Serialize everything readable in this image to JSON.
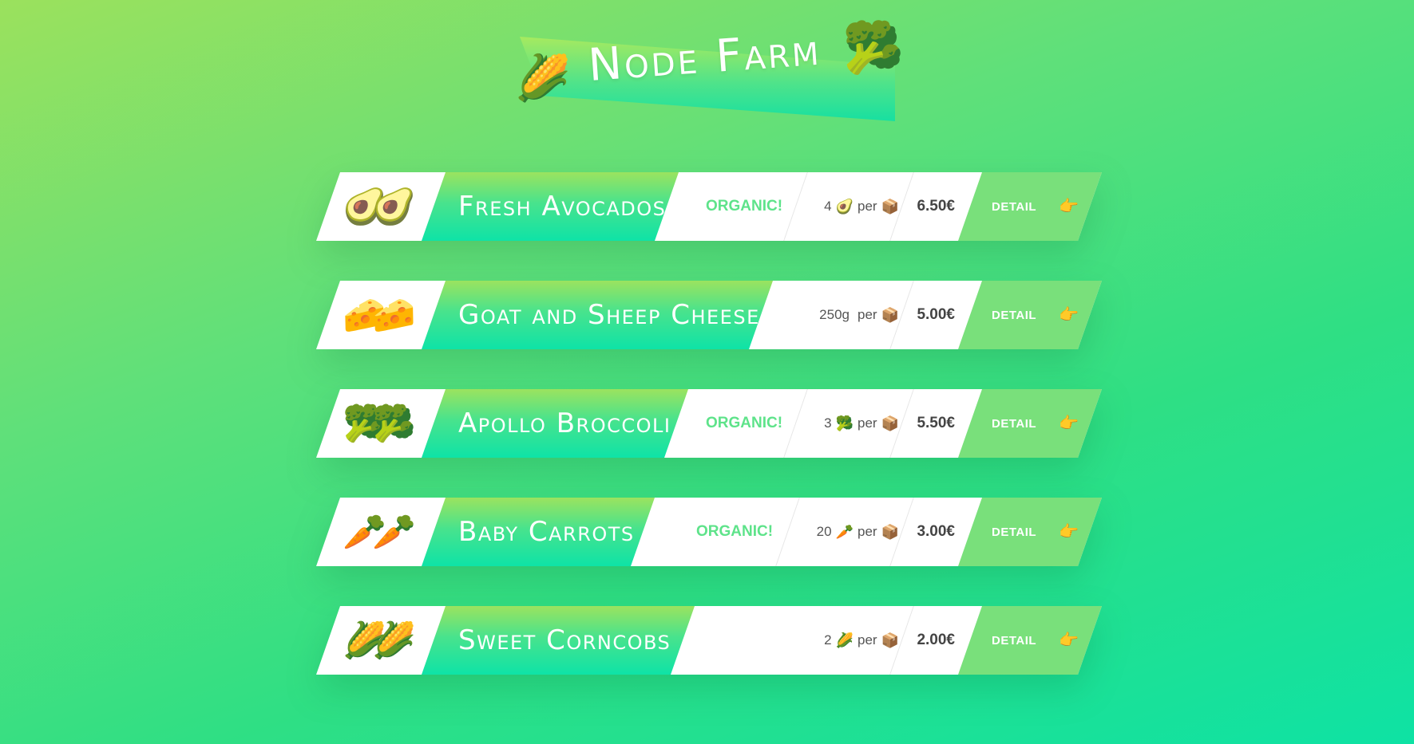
{
  "header": {
    "title": "Node Farm",
    "emoji_left": "🌽",
    "emoji_right": "🥦"
  },
  "products": [
    {
      "emoji": "🥑🥑",
      "name": "Fresh Avocados",
      "organic_label": "ORGANIC!",
      "quantity_count": "4",
      "quantity_emoji": "🥑",
      "per_label": "per",
      "box_emoji": "📦",
      "price": "6.50€",
      "detail_label": "DETAIL",
      "detail_icon": "👉"
    },
    {
      "emoji": "🧀🧀",
      "name": "Goat and Sheep Cheese",
      "organic_label": "",
      "quantity_count": "250g",
      "quantity_emoji": "",
      "per_label": "per",
      "box_emoji": "📦",
      "price": "5.00€",
      "detail_label": "DETAIL",
      "detail_icon": "👉"
    },
    {
      "emoji": "🥦🥦",
      "name": "Apollo Broccoli",
      "organic_label": "ORGANIC!",
      "quantity_count": "3",
      "quantity_emoji": "🥦",
      "per_label": "per",
      "box_emoji": "📦",
      "price": "5.50€",
      "detail_label": "DETAIL",
      "detail_icon": "👉"
    },
    {
      "emoji": "🥕🥕",
      "name": "Baby Carrots",
      "organic_label": "ORGANIC!",
      "quantity_count": "20",
      "quantity_emoji": "🥕",
      "per_label": "per",
      "box_emoji": "📦",
      "price": "3.00€",
      "detail_label": "DETAIL",
      "detail_icon": "👉"
    },
    {
      "emoji": "🌽🌽",
      "name": "Sweet Corncobs",
      "organic_label": "",
      "quantity_count": "2",
      "quantity_emoji": "🌽",
      "per_label": "per",
      "box_emoji": "📦",
      "price": "2.00€",
      "detail_label": "DETAIL",
      "detail_icon": "👉"
    }
  ],
  "colors": {
    "organic_text": "#5ee38a",
    "detail_background": "#79e07b",
    "name_gradient_top": "#9be35f",
    "name_gradient_bottom": "#0ee3a7"
  }
}
